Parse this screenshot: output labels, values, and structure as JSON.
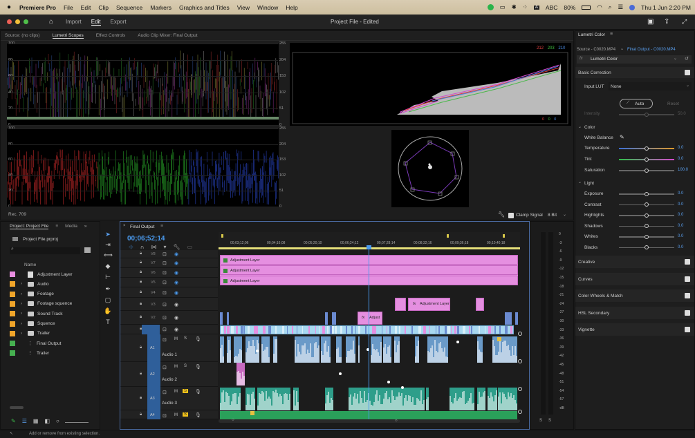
{
  "menubar": {
    "app": "Premiere Pro",
    "items": [
      "File",
      "Edit",
      "Clip",
      "Sequence",
      "Markers",
      "Graphics and Titles",
      "View",
      "Window",
      "Help"
    ],
    "keyboard": "ABC",
    "battery": "80%",
    "datetime": "Thu 1 Jun  2:20 PM"
  },
  "header": {
    "tabs": [
      "Import",
      "Edit",
      "Export"
    ],
    "active_tab": "Edit",
    "title": "Project File - Edited"
  },
  "source_panel": {
    "tabs": [
      "Source: (no clips)",
      "Lumetri Scopes",
      "Effect Controls",
      "Audio Clip Mixer: Final Output"
    ],
    "active": "Lumetri Scopes",
    "left_ticks": [
      "100",
      "80",
      "60",
      "40",
      "20",
      "0"
    ],
    "right_ticks": [
      "255",
      "204",
      "153",
      "102",
      "51",
      "0"
    ],
    "hist_values": {
      "r": "212",
      "g": "203",
      "b": "210"
    },
    "hist_bottom": {
      "v1": "0",
      "v2": "0",
      "v3": "0"
    },
    "rec": "Rec. 709",
    "clamp_label": "Clamp Signal",
    "bit": "8 Bit"
  },
  "lumetri": {
    "title": "Lumetri Color",
    "source": "Source - C0020.MP4",
    "target": "Final Output - C0020.MP4",
    "effect": "Lumetri Color",
    "basic": "Basic Correction",
    "input_lut_label": "Input LUT",
    "input_lut_value": "None",
    "auto": "Auto",
    "reset": "Reset",
    "intensity_label": "Intensity",
    "intensity_value": "50.0",
    "color_section": "Color",
    "white_balance": "White Balance",
    "rows": [
      {
        "label": "Temperature",
        "value": "0.0"
      },
      {
        "label": "Tint",
        "value": "0.0"
      },
      {
        "label": "Saturation",
        "value": "100.0"
      }
    ],
    "light_section": "Light",
    "light_rows": [
      {
        "label": "Exposure",
        "value": "0.0"
      },
      {
        "label": "Contrast",
        "value": "0.0"
      },
      {
        "label": "Highlights",
        "value": "0.0"
      },
      {
        "label": "Shadows",
        "value": "0.0"
      },
      {
        "label": "Whites",
        "value": "0.0"
      },
      {
        "label": "Blacks",
        "value": "0.0"
      }
    ],
    "sections": [
      "Creative",
      "Curves",
      "Color Wheels & Match",
      "HSL Secondary",
      "Vignette"
    ],
    "colors": {
      "accent": "#2d8ceb",
      "temp_grad_start": "#3a6fd8",
      "temp_grad_end": "#e09a2a",
      "tint_start": "#2fc24a",
      "tint_end": "#d64ad0"
    }
  },
  "project": {
    "tabs": [
      "Project: Project File",
      "Media"
    ],
    "file": "Project File.prproj",
    "column": "Name",
    "items": [
      {
        "name": "Adjustment Layer",
        "color": "#e88ee0",
        "kind": "clip"
      },
      {
        "name": "Audio",
        "color": "#f0a52a",
        "kind": "folder"
      },
      {
        "name": "Footage",
        "color": "#f0a52a",
        "kind": "folder"
      },
      {
        "name": "Footage squence",
        "color": "#f0a52a",
        "kind": "folder"
      },
      {
        "name": "Sound Track",
        "color": "#f0a52a",
        "kind": "folder"
      },
      {
        "name": "Squence",
        "color": "#f0a52a",
        "kind": "folder"
      },
      {
        "name": "Trailer",
        "color": "#f0a52a",
        "kind": "folder"
      },
      {
        "name": "Final Output",
        "color": "#46b050",
        "kind": "seq"
      },
      {
        "name": "Trailer",
        "color": "#46b050",
        "kind": "seq"
      }
    ]
  },
  "timeline": {
    "title": "Final Output",
    "timecode": "00;06;52;14",
    "ruler": [
      "00;03;12;06",
      "00;04;16;08",
      "00;05;20;10",
      "00;06;24;12",
      "00;07;28;14",
      "00;08;32;16",
      "00;09;36;18",
      "00;10;40;18"
    ],
    "video_tracks": [
      "V8",
      "V7",
      "V6",
      "V5",
      "V4",
      "V3",
      "V2",
      "V1"
    ],
    "audio_tracks": [
      {
        "id": "A1",
        "name": "Audio 1"
      },
      {
        "id": "A2",
        "name": "Audio 2"
      },
      {
        "id": "A3",
        "name": "Audio 3"
      },
      {
        "id": "A4",
        "name": ""
      }
    ],
    "adjustment_label": "Adjustment Layer",
    "adjust_short": "Adjust",
    "fx": "fx",
    "meter_ticks": [
      "0",
      "-3",
      "-6",
      "-9",
      "-12",
      "-15",
      "-18",
      "-21",
      "-24",
      "-27",
      "-30",
      "-33",
      "-36",
      "-39",
      "-42",
      "-45",
      "-48",
      "-51",
      "-54",
      "-57",
      "-dB"
    ],
    "solo": "S"
  },
  "status": "Add or remove from existing selection."
}
